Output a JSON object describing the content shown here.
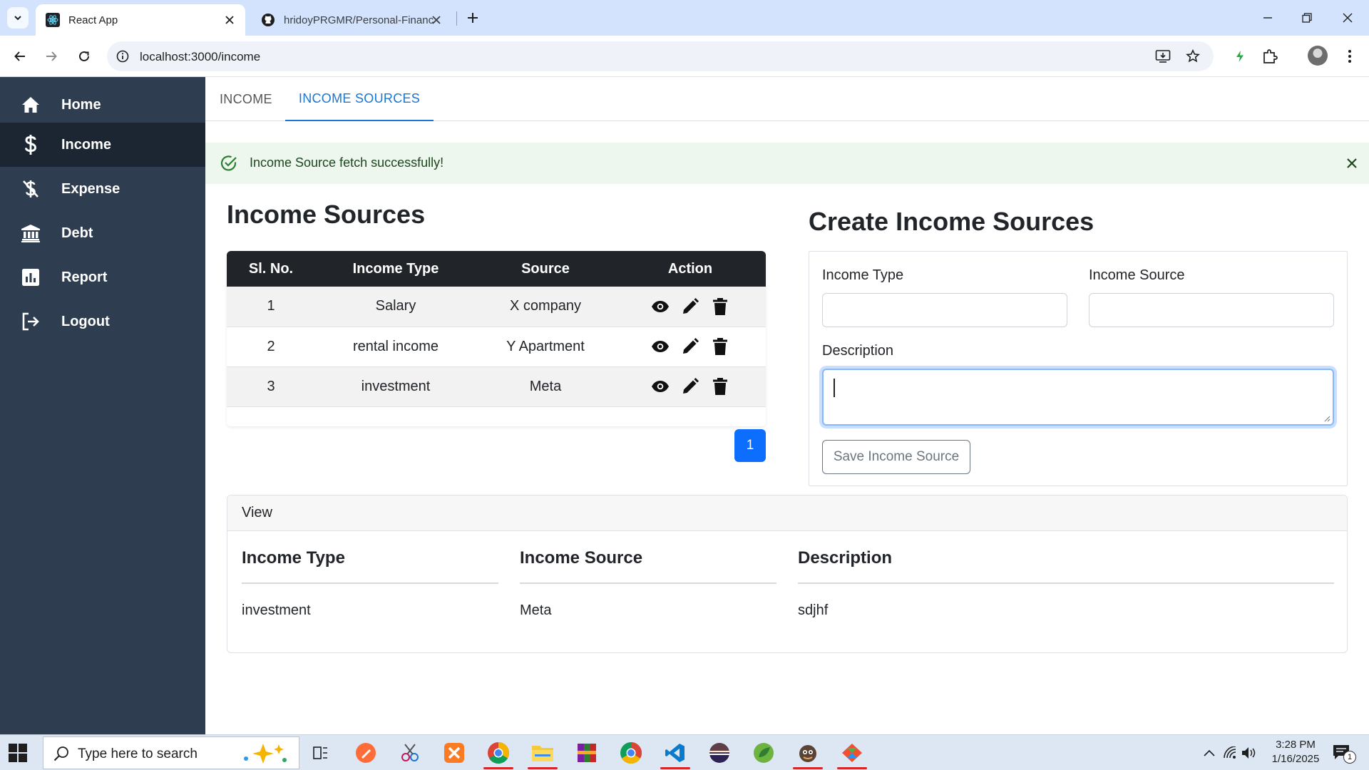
{
  "browser": {
    "tabs": [
      {
        "title": "React App",
        "active": true
      },
      {
        "title": "hridoyPRGMR/Personal-Finance",
        "active": false
      }
    ],
    "url": "localhost:3000/income"
  },
  "sidebar": {
    "items": [
      {
        "label": "Home",
        "icon": "home-icon",
        "active": false
      },
      {
        "label": "Income",
        "icon": "dollar-icon",
        "active": true
      },
      {
        "label": "Expense",
        "icon": "expense-icon",
        "active": false
      },
      {
        "label": "Debt",
        "icon": "bank-icon",
        "active": false
      },
      {
        "label": "Report",
        "icon": "chart-icon",
        "active": false
      },
      {
        "label": "Logout",
        "icon": "logout-icon",
        "active": false
      }
    ]
  },
  "page_tabs": [
    {
      "label": "INCOME",
      "active": false
    },
    {
      "label": "INCOME SOURCES",
      "active": true
    }
  ],
  "alert": {
    "message": "Income Source fetch successfully!"
  },
  "list": {
    "title": "Income Sources",
    "columns": [
      "Sl. No.",
      "Income Type",
      "Source",
      "Action"
    ],
    "rows": [
      {
        "sl": "1",
        "type": "Salary",
        "source": "X company"
      },
      {
        "sl": "2",
        "type": "rental income",
        "source": "Y Apartment"
      },
      {
        "sl": "3",
        "type": "investment",
        "source": "Meta"
      }
    ],
    "pagination": {
      "current_page": "1"
    }
  },
  "form": {
    "title": "Create Income Sources",
    "income_type_label": "Income Type",
    "income_type_value": "",
    "income_source_label": "Income Source",
    "income_source_value": "",
    "description_label": "Description",
    "description_value": "",
    "save_label": "Save Income Source"
  },
  "view": {
    "header": "View",
    "income_type_label": "Income Type",
    "income_type_value": "investment",
    "income_source_label": "Income Source",
    "income_source_value": "Meta",
    "description_label": "Description",
    "description_value": "sdjhf"
  },
  "taskbar": {
    "search_placeholder": "Type here to search",
    "time": "3:28 PM",
    "date": "1/16/2025",
    "notification_count": "1"
  },
  "colors": {
    "sidebar_bg": "#2e3e50",
    "sidebar_active": "#1b2632",
    "accent": "#1976d2",
    "primary_button": "#0d6efd",
    "success_bg": "#edf7ed",
    "table_header": "#212529"
  }
}
